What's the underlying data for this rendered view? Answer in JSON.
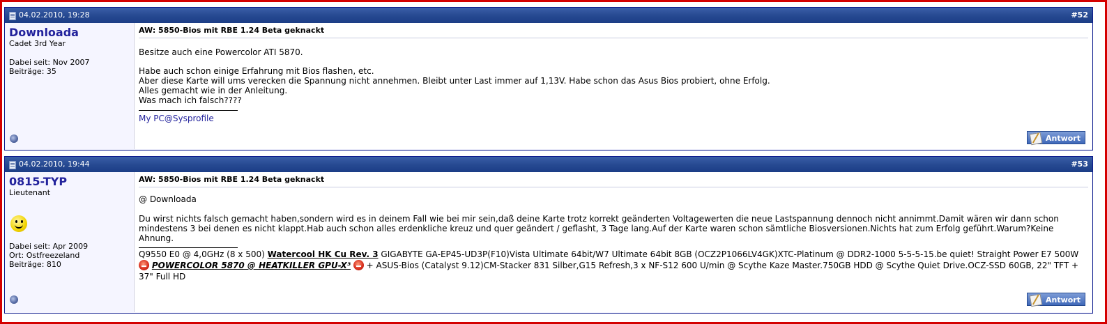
{
  "posts": [
    {
      "date": "04.02.2010, 19:28",
      "number": "#52",
      "user": {
        "name": "Downloada",
        "rank": "Cadet 3rd Year",
        "joined": "Dabei seit: Nov 2007",
        "posts": "Beiträge: 35"
      },
      "title": "AW: 5850-Bios mit RBE 1.24 Beta geknackt",
      "lines": [
        "Besitze auch eine Powercolor ATI 5870.",
        "Habe auch schon einige Erfahrung mit Bios flashen, etc.",
        "Aber diese Karte will ums verecken die Spannung nicht annehmen. Bleibt unter Last immer auf 1,13V. Habe schon das Asus Bios probiert, ohne Erfolg.",
        "Alles gemacht wie in der Anleitung.",
        "Was mach ich falsch????"
      ],
      "signature_link": "My PC@Sysprofile",
      "reply_label": "Antwort"
    },
    {
      "date": "04.02.2010, 19:44",
      "number": "#53",
      "user": {
        "name": "0815-TYP",
        "rank": "Lieutenant",
        "joined": "Dabei seit: Apr 2009",
        "location": "Ort: Ostfreezeland",
        "posts": "Beiträge: 810"
      },
      "title": "AW: 5850-Bios mit RBE 1.24 Beta geknackt",
      "lines": [
        "@ Downloada",
        "Du wirst nichts falsch gemacht haben,sondern wird es in deinem Fall wie bei mir sein,daß deine Karte trotz korrekt geänderten Voltagewerten die neue Lastspannung dennoch nicht annimmt.Damit wären wir dann schon mindestens 3 bei denen es nicht klappt.Hab auch schon alles erdenkliche kreuz und quer geändert / geflasht, 3 Tage lang.Auf der Karte waren schon sämtliche Biosversionen.Nichts hat zum Erfolg geführt.Warum?Keine Ahnung."
      ],
      "signature": {
        "part1": "Q9550 E0 @ 4,0GHz (8 x 500) ",
        "link1": "Watercool HK Cu Rev. 3",
        "part2": " GIGABYTE GA-EP45-UD3P(F10)Vista Ultimate 64bit/W7 Ultimate 64bit 8GB (OCZ2P1066LV4GK)XTC-Platinum @ DDR2-1000 5-5-5-15.be quiet! Straight Power E7 500W",
        "link2": "POWERCOLOR 5870 @ HEATKILLER GPU-X³",
        "part3": " + ASUS-Bios (Catalyst 9.12)CM-Stacker 831 Silber,G15 Refresh,3 x NF-S12 600 U/min @ Scythe Kaze Master.750GB HDD @ Scythe Quiet Drive.OCZ-SSD 60GB, 22\" TFT + 37\" Full HD"
      },
      "reply_label": "Antwort"
    }
  ]
}
